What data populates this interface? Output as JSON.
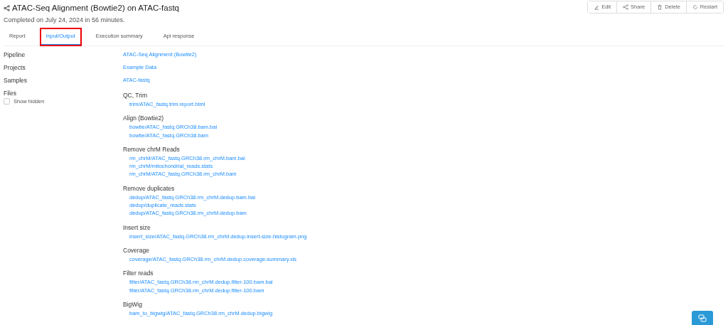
{
  "title": "ATAC-Seq Alignment (Bowtie2) on ATAC-fastq",
  "subtitle": "Completed on July 24, 2024 in 56 minutes.",
  "actions": [
    {
      "label": "Edit",
      "kind": "edit"
    },
    {
      "label": "Share",
      "kind": "share"
    },
    {
      "label": "Delete",
      "kind": "delete"
    },
    {
      "label": "Restart",
      "kind": "restart"
    }
  ],
  "tabs": [
    {
      "label": "Report",
      "selected": false,
      "highlighted": false
    },
    {
      "label": "Input/Output",
      "selected": true,
      "highlighted": true
    },
    {
      "label": "Execution summary",
      "selected": false,
      "highlighted": false
    },
    {
      "label": "Api response",
      "selected": false,
      "highlighted": false
    }
  ],
  "details": [
    {
      "label": "Pipeline",
      "value": "ATAC-Seq Alignment (Bowtie2)"
    },
    {
      "label": "Projects",
      "value": "Example Data"
    },
    {
      "label": "Samples",
      "value": "ATAC-fastq"
    }
  ],
  "files": {
    "label": "Files",
    "show_hidden": {
      "label": "Show hidden",
      "checked": false
    },
    "groups": [
      {
        "heading": "QC, Trim",
        "files": [
          "trim/ATAC_fastq.trim.report.html"
        ]
      },
      {
        "heading": "Align (Bowtie2)",
        "files": [
          "bowtie/ATAC_fastq.GRCh38.bam.bai",
          "bowtie/ATAC_fastq.GRCh38.bam"
        ]
      },
      {
        "heading": "Remove chrM Reads",
        "files": [
          "rm_chrM/ATAC_fastq.GRCh38.rm_chrM.bam.bai",
          "rm_chrM/mitochondrial_reads.stats",
          "rm_chrM/ATAC_fastq.GRCh38.rm_chrM.bam"
        ]
      },
      {
        "heading": "Remove duplicates",
        "files": [
          "dedup/ATAC_fastq.GRCh38.rm_chrM.dedup.bam.bai",
          "dedup/duplicate_reads.stats",
          "dedup/ATAC_fastq.GRCh38.rm_chrM.dedup.bam"
        ]
      },
      {
        "heading": "Insert size",
        "files": [
          "insert_size/ATAC_fastq.GRCh38.rm_chrM.dedup.insert-size-histogram.png"
        ]
      },
      {
        "heading": "Coverage",
        "files": [
          "coverage/ATAC_fastq.GRCh38.rm_chrM.dedup.coverage-summary.xls"
        ]
      },
      {
        "heading": "Filter reads",
        "files": [
          "filter/ATAC_fastq.GRCh38.rm_chrM.dedup.filter-100.bam.bai",
          "filter/ATAC_fastq.GRCh38.rm_chrM.dedup.filter-100.bam"
        ]
      },
      {
        "heading": "BigWig",
        "files": [
          "bam_to_bigwig/ATAC_fastq.GRCh38.rm_chrM.dedup.bigwig"
        ]
      }
    ]
  }
}
